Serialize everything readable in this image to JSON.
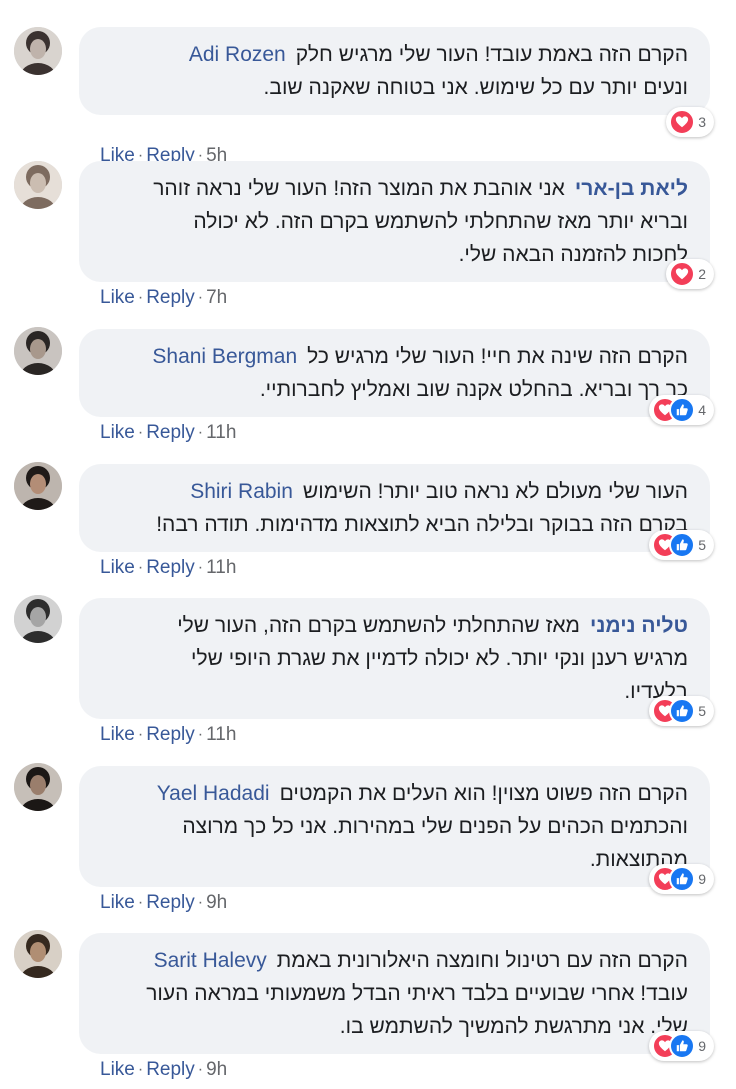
{
  "comments": [
    {
      "author": "Adi Rozen",
      "author_rtl": false,
      "avatar": "avatar-photo",
      "lines": [
        "הקרם הזה באמת עובד! העור שלי מרגיש חלק",
        "ונעים יותר עם כל שימוש. אני בטוחה שאקנה שוב."
      ],
      "reactions": [
        "love-icon"
      ],
      "reaction_count": "3",
      "like_label": "Like",
      "reply_label": "Reply",
      "time": "5h"
    },
    {
      "author": "ליאת בן-ארי",
      "author_rtl": true,
      "avatar": "avatar-photo",
      "lines": [
        "אני אוהבת את המוצר הזה! העור שלי נראה זוהר",
        "ובריא יותר מאז שהתחלתי להשתמש בקרם הזה. לא יכולה",
        "לחכות להזמנה הבאה שלי."
      ],
      "reactions": [
        "love-icon"
      ],
      "reaction_count": "2",
      "like_label": "Like",
      "reply_label": "Reply",
      "time": "7h"
    },
    {
      "author": "Shani Bergman",
      "author_rtl": false,
      "avatar": "avatar-photo",
      "lines": [
        "הקרם הזה שינה את חיי! העור שלי מרגיש כל",
        "כך רך ובריא. בהחלט אקנה שוב ואמליץ לחברותיי."
      ],
      "reactions": [
        "love-icon",
        "like-icon"
      ],
      "reaction_count": "4",
      "like_label": "Like",
      "reply_label": "Reply",
      "time": "11h"
    },
    {
      "author": "Shiri Rabin",
      "author_rtl": false,
      "avatar": "avatar-photo",
      "lines": [
        "העור שלי מעולם לא נראה טוב יותר! השימוש",
        "בקרם הזה בבוקר ובלילה הביא לתוצאות מדהימות. תודה רבה!"
      ],
      "reactions": [
        "love-icon",
        "like-icon"
      ],
      "reaction_count": "5",
      "like_label": "Like",
      "reply_label": "Reply",
      "time": "11h"
    },
    {
      "author": "טליה נימני",
      "author_rtl": true,
      "avatar": "avatar-photo",
      "lines": [
        "מאז שהתחלתי להשתמש בקרם הזה, העור שלי",
        "מרגיש רענן ונקי יותר. לא יכולה לדמיין את שגרת היופי שלי",
        "בלעדיו."
      ],
      "reactions": [
        "love-icon",
        "like-icon"
      ],
      "reaction_count": "5",
      "like_label": "Like",
      "reply_label": "Reply",
      "time": "11h"
    },
    {
      "author": "Yael Hadadi",
      "author_rtl": false,
      "avatar": "avatar-photo",
      "lines": [
        "הקרם הזה פשוט מצוין! הוא העלים את הקמטים",
        "והכתמים הכהים על הפנים שלי במהירות. אני כל כך מרוצה",
        "מהתוצאות."
      ],
      "reactions": [
        "love-icon",
        "like-icon"
      ],
      "reaction_count": "9",
      "like_label": "Like",
      "reply_label": "Reply",
      "time": "9h"
    },
    {
      "author": "Sarit Halevy",
      "author_rtl": false,
      "avatar": "avatar-photo",
      "lines": [
        "הקרם הזה עם רטינול וחומצה היאלורונית באמת",
        "עובד! אחרי שבועיים בלבד ראיתי הבדל משמעותי במראה העור",
        "שלי. אני מתרגשת להמשיך להשתמש בו."
      ],
      "reactions": [
        "love-icon",
        "like-icon"
      ],
      "reaction_count": "9",
      "like_label": "Like",
      "reply_label": "Reply",
      "time": "9h"
    }
  ],
  "colors": {
    "author_link": "#385898",
    "bubble_bg": "#f0f2f5",
    "love": "#f33e58",
    "like": "#1877f2",
    "meta_gray": "#65676b"
  }
}
